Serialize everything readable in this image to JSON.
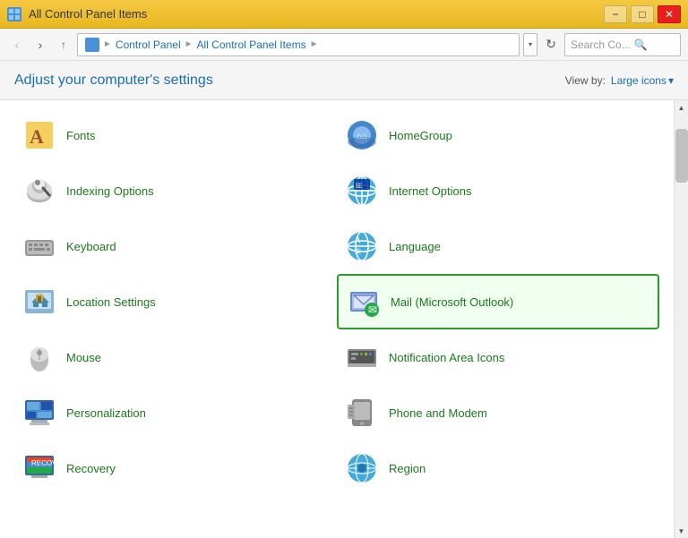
{
  "titleBar": {
    "title": "All Control Panel Items",
    "minimizeLabel": "−",
    "restoreLabel": "□",
    "closeLabel": "✕"
  },
  "addressBar": {
    "backLabel": "‹",
    "forwardLabel": "›",
    "upLabel": "↑",
    "breadcrumb": [
      "Control Panel",
      "All Control Panel Items"
    ],
    "searchPlaceholder": "Search Co...",
    "searchIcon": "🔍",
    "refreshLabel": "↻",
    "dropdownLabel": "▾"
  },
  "toolbar": {
    "adjustText": "Adjust your computer's settings",
    "viewByLabel": "View by:",
    "viewByValue": "Large icons",
    "viewByDropdown": "▾"
  },
  "items": [
    {
      "id": "fonts",
      "label": "Fonts",
      "icon": "fonts"
    },
    {
      "id": "homegroup",
      "label": "HomeGroup",
      "icon": "homegroup"
    },
    {
      "id": "indexing",
      "label": "Indexing Options",
      "icon": "indexing"
    },
    {
      "id": "internet",
      "label": "Internet Options",
      "icon": "internet"
    },
    {
      "id": "keyboard",
      "label": "Keyboard",
      "icon": "keyboard"
    },
    {
      "id": "language",
      "label": "Language",
      "icon": "language"
    },
    {
      "id": "location",
      "label": "Location Settings",
      "icon": "location"
    },
    {
      "id": "mail",
      "label": "Mail (Microsoft Outlook)",
      "icon": "mail",
      "highlighted": true
    },
    {
      "id": "mouse",
      "label": "Mouse",
      "icon": "mouse"
    },
    {
      "id": "notification",
      "label": "Notification Area Icons",
      "icon": "notification"
    },
    {
      "id": "personalization",
      "label": "Personalization",
      "icon": "personalization"
    },
    {
      "id": "phone",
      "label": "Phone and Modem",
      "icon": "phone"
    },
    {
      "id": "recovery",
      "label": "Recovery",
      "icon": "recovery"
    },
    {
      "id": "region",
      "label": "Region",
      "icon": "region"
    }
  ],
  "colors": {
    "accent": "#1a6fb3",
    "itemLabel": "#1a7a1a",
    "highlightBorder": "#2a9a2a",
    "titleBarGold": "#f5c842"
  }
}
